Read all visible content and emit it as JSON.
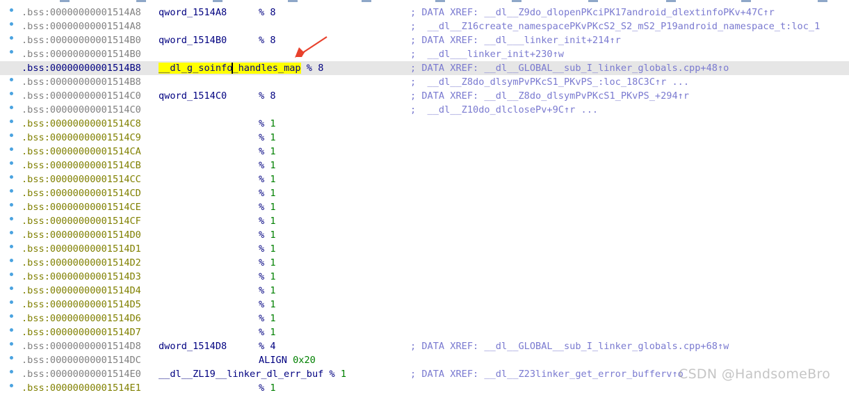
{
  "gutter_dot_color": "#4aa3e0",
  "rows": [
    {
      "addr": ".bss:00000000001514A8",
      "name": "qword_1514A8",
      "op": "% ",
      "opnum": "8",
      "comment": "; DATA XREF: __dl__Z9do_dlopenPKciPK17android_dlextinfoPKv+47C↑r",
      "kind": "code"
    },
    {
      "addr": ".bss:00000000001514A8",
      "name": "",
      "op": "",
      "opnum": "",
      "comment": ";  __dl__Z16create_namespacePKvPKcS2_S2_mS2_P19android_namespace_t:loc_1",
      "kind": "code"
    },
    {
      "addr": ".bss:00000000001514B0",
      "name": "qword_1514B0",
      "op": "% ",
      "opnum": "8",
      "comment": "; DATA XREF: __dl___linker_init+214↑r",
      "kind": "code"
    },
    {
      "addr": ".bss:00000000001514B0",
      "name": "",
      "op": "",
      "opnum": "",
      "comment": ";  __dl___linker_init+230↑w",
      "kind": "code"
    },
    {
      "addr": ".bss:00000000001514B8",
      "name_a": "__dl_g_soinfo",
      "name_b": "_handles_map",
      "op": "% ",
      "opnum": "8",
      "comment": "; DATA XREF: __dl__GLOBAL__sub_I_linker_globals.cpp+48↑o",
      "kind": "selected"
    },
    {
      "addr": ".bss:00000000001514B8",
      "name": "",
      "op": "",
      "opnum": "",
      "comment": ";  __dl__Z8do_dlsymPvPKcS1_PKvPS_:loc_18C3C↑r ...",
      "kind": "code"
    },
    {
      "addr": ".bss:00000000001514C0",
      "name": "qword_1514C0",
      "op": "% ",
      "opnum": "8",
      "comment": "; DATA XREF: __dl__Z8do_dlsymPvPKcS1_PKvPS_+294↑r",
      "kind": "code"
    },
    {
      "addr": ".bss:00000000001514C0",
      "name": "",
      "op": "",
      "opnum": "",
      "comment": ";  __dl__Z10do_dlclosePv+9C↑r ...",
      "kind": "code"
    },
    {
      "addr": ".bss:00000000001514C8",
      "name": "",
      "op": "% ",
      "opnum": "1",
      "comment": "",
      "kind": "data"
    },
    {
      "addr": ".bss:00000000001514C9",
      "name": "",
      "op": "% ",
      "opnum": "1",
      "comment": "",
      "kind": "data"
    },
    {
      "addr": ".bss:00000000001514CA",
      "name": "",
      "op": "% ",
      "opnum": "1",
      "comment": "",
      "kind": "data"
    },
    {
      "addr": ".bss:00000000001514CB",
      "name": "",
      "op": "% ",
      "opnum": "1",
      "comment": "",
      "kind": "data"
    },
    {
      "addr": ".bss:00000000001514CC",
      "name": "",
      "op": "% ",
      "opnum": "1",
      "comment": "",
      "kind": "data"
    },
    {
      "addr": ".bss:00000000001514CD",
      "name": "",
      "op": "% ",
      "opnum": "1",
      "comment": "",
      "kind": "data"
    },
    {
      "addr": ".bss:00000000001514CE",
      "name": "",
      "op": "% ",
      "opnum": "1",
      "comment": "",
      "kind": "data"
    },
    {
      "addr": ".bss:00000000001514CF",
      "name": "",
      "op": "% ",
      "opnum": "1",
      "comment": "",
      "kind": "data"
    },
    {
      "addr": ".bss:00000000001514D0",
      "name": "",
      "op": "% ",
      "opnum": "1",
      "comment": "",
      "kind": "data"
    },
    {
      "addr": ".bss:00000000001514D1",
      "name": "",
      "op": "% ",
      "opnum": "1",
      "comment": "",
      "kind": "data"
    },
    {
      "addr": ".bss:00000000001514D2",
      "name": "",
      "op": "% ",
      "opnum": "1",
      "comment": "",
      "kind": "data"
    },
    {
      "addr": ".bss:00000000001514D3",
      "name": "",
      "op": "% ",
      "opnum": "1",
      "comment": "",
      "kind": "data"
    },
    {
      "addr": ".bss:00000000001514D4",
      "name": "",
      "op": "% ",
      "opnum": "1",
      "comment": "",
      "kind": "data"
    },
    {
      "addr": ".bss:00000000001514D5",
      "name": "",
      "op": "% ",
      "opnum": "1",
      "comment": "",
      "kind": "data"
    },
    {
      "addr": ".bss:00000000001514D6",
      "name": "",
      "op": "% ",
      "opnum": "1",
      "comment": "",
      "kind": "data"
    },
    {
      "addr": ".bss:00000000001514D7",
      "name": "",
      "op": "% ",
      "opnum": "1",
      "comment": "",
      "kind": "data"
    },
    {
      "addr": ".bss:00000000001514D8",
      "name": "dword_1514D8",
      "op": "% ",
      "opnum": "4",
      "comment": "; DATA XREF: __dl__GLOBAL__sub_I_linker_globals.cpp+68↑w",
      "kind": "code"
    },
    {
      "addr": ".bss:00000000001514DC",
      "name": "",
      "op": "ALIGN ",
      "opnum": "0x20",
      "comment": "",
      "kind": "code"
    },
    {
      "addr": ".bss:00000000001514E0",
      "name": "__dl__ZL19__linker_dl_err_buf",
      "op": "",
      "opnum": "",
      "inline_op": " % ",
      "inline_num": "1",
      "comment": "; DATA XREF: __dl__Z23linker_get_error_bufferv↑o",
      "kind": "code"
    },
    {
      "addr": ".bss:00000000001514E1",
      "name": "",
      "op": "% ",
      "opnum": "1",
      "comment": "",
      "kind": "data"
    }
  ],
  "watermark": "CSDN @HandsomeBro"
}
